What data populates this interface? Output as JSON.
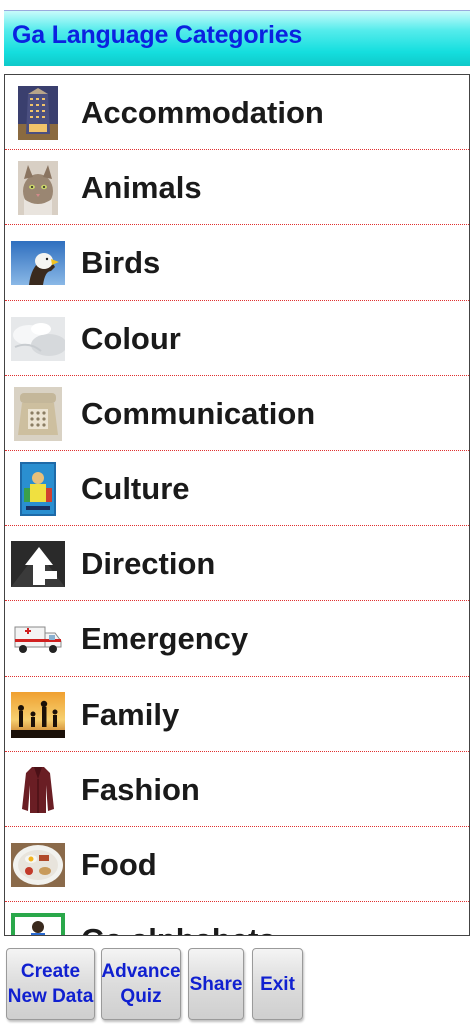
{
  "header": {
    "title": "Ga Language Categories"
  },
  "categories": [
    {
      "label": "Accommodation",
      "icon": "hotel-building-icon"
    },
    {
      "label": "Animals",
      "icon": "cat-icon"
    },
    {
      "label": "Birds",
      "icon": "eagle-icon"
    },
    {
      "label": "Colour",
      "icon": "white-fur-icon"
    },
    {
      "label": "Communication",
      "icon": "telephone-icon"
    },
    {
      "label": "Culture",
      "icon": "culture-poster-icon"
    },
    {
      "label": "Direction",
      "icon": "direction-sign-icon"
    },
    {
      "label": "Emergency",
      "icon": "ambulance-icon"
    },
    {
      "label": "Family",
      "icon": "family-silhouette-icon"
    },
    {
      "label": "Fashion",
      "icon": "leather-jacket-icon"
    },
    {
      "label": "Food",
      "icon": "food-plate-icon"
    },
    {
      "label": "Ga alphabets",
      "icon": "alphabet-chart-icon"
    }
  ],
  "toolbar": {
    "create_line1": "Create",
    "create_line2": "New Data",
    "quiz_line1": "Advance",
    "quiz_line2": "Quiz",
    "share": "Share",
    "exit": "Exit"
  }
}
